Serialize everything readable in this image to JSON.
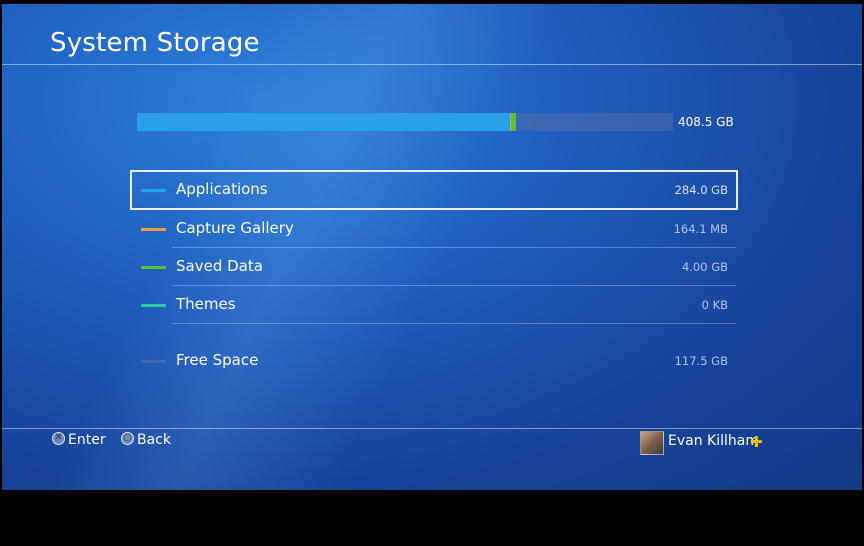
{
  "header": {
    "title": "System Storage"
  },
  "storage": {
    "total": "408.5 GB",
    "used_fraction": 0.705,
    "segments": [
      {
        "name": "Applications",
        "fraction": 0.695,
        "color": "#2aa0e8"
      },
      {
        "name": "Capture Gallery",
        "fraction": 0.002,
        "color": "#e6a23c"
      },
      {
        "name": "Saved Data",
        "fraction": 0.01,
        "color": "#5fbf3a"
      },
      {
        "name": "Themes",
        "fraction": 0.0,
        "color": "#2fc8a3"
      }
    ],
    "free_color": "#6a86b8"
  },
  "categories": [
    {
      "label": "Applications",
      "size": "284.0 GB",
      "color": "#2aa0e8",
      "selected": true
    },
    {
      "label": "Capture Gallery",
      "size": "164.1 MB",
      "color": "#e6a23c",
      "selected": false
    },
    {
      "label": "Saved Data",
      "size": "4.00 GB",
      "color": "#5fbf3a",
      "selected": false
    },
    {
      "label": "Themes",
      "size": "0 KB",
      "color": "#2fc8a3",
      "selected": false
    },
    {
      "label": "Free Space",
      "size": "117.5 GB",
      "color": "#4d6fa8",
      "selected": false
    }
  ],
  "footer": {
    "enter_label": "Enter",
    "back_label": "Back",
    "enter_icon": "cross-button-icon",
    "back_icon": "circle-button-icon",
    "user_name": "Evan Killham",
    "plus_icon": "ps-plus-icon",
    "plus_color": "#f2c200"
  }
}
